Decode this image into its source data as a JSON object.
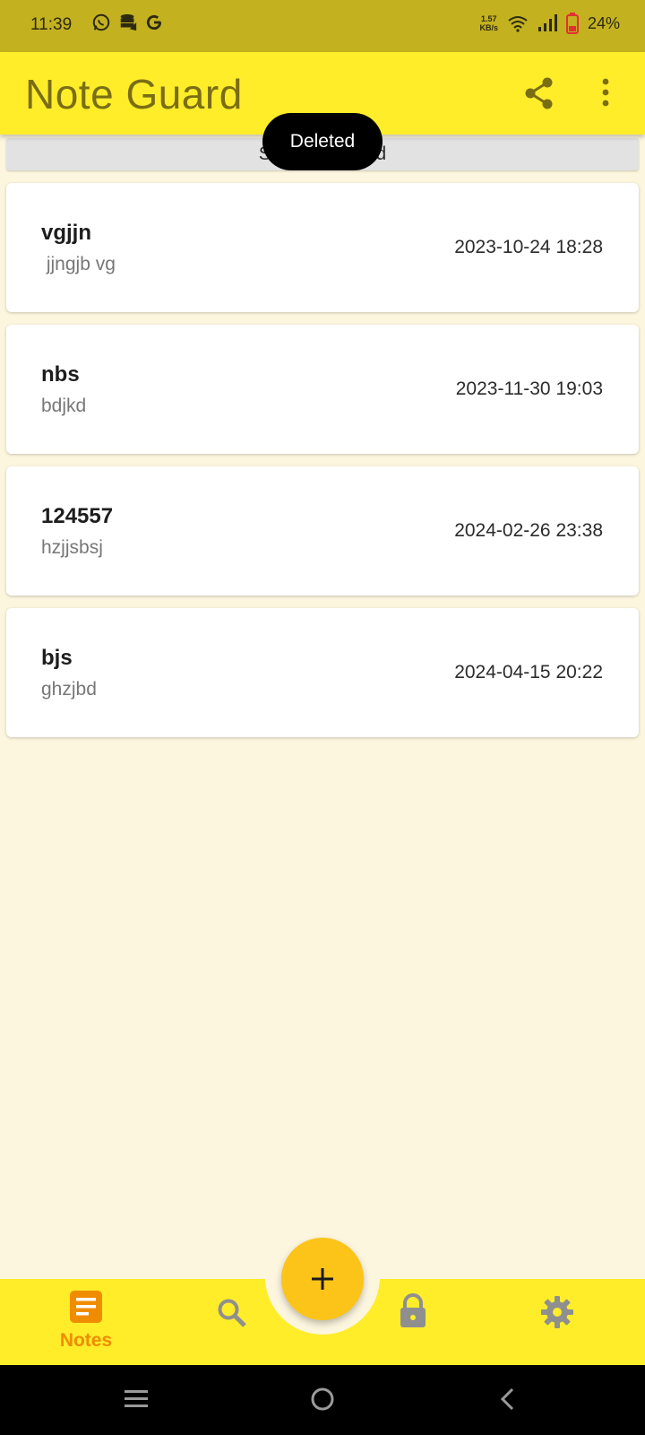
{
  "status_bar": {
    "time": "11:39",
    "speed_value": "1.57",
    "speed_unit": "KB/s",
    "battery": "24%"
  },
  "app_bar": {
    "title": "Note Guard"
  },
  "sort_bar": {
    "label": "Sort by method"
  },
  "toast": {
    "text": "Deleted"
  },
  "notes": [
    {
      "title": "vgjjn",
      "body": " jjngjb vg",
      "date": "2023-10-24 18:28"
    },
    {
      "title": "nbs",
      "body": "bdjkd",
      "date": "2023-11-30 19:03"
    },
    {
      "title": "124557",
      "body": "hzjjsbsj",
      "date": "2024-02-26 23:38"
    },
    {
      "title": "bjs",
      "body": "ghzjbd",
      "date": "2024-04-15 20:22"
    }
  ],
  "bottom_nav": {
    "notes_label": "Notes",
    "active_color": "#f08c00",
    "inactive_color": "#8f8f8f"
  },
  "icons": {
    "share": "share-icon",
    "more": "more-vert-icon",
    "add": "add-icon",
    "notes": "notes-icon",
    "search": "search-icon",
    "lock": "lock-icon",
    "settings": "gear-icon"
  }
}
